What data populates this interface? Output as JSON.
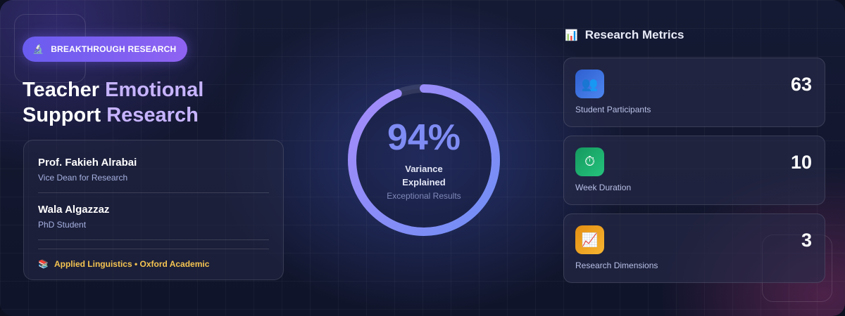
{
  "badge": {
    "icon": "microscope-icon",
    "glyph": "🔬",
    "label": "BREAKTHROUGH RESEARCH"
  },
  "title": {
    "line1_a": "Teacher",
    "line1_b": "Emotional",
    "line2_a": "Support",
    "line2_b": "Research"
  },
  "authors": [
    {
      "name": "Prof. Fakieh Alrabai",
      "role": "Vice Dean for Research"
    },
    {
      "name": "Wala Algazzaz",
      "role": "PhD Student"
    }
  ],
  "journal": {
    "icon": "books-icon",
    "glyph": "📚",
    "label": "Applied Linguistics • Oxford Academic"
  },
  "stat": {
    "value_text": "94%",
    "progress": 94,
    "label_line1": "Variance",
    "label_line2": "Explained",
    "sublabel": "Exceptional Results"
  },
  "metrics": {
    "header_icon": "bar-chart-icon",
    "header_glyph": "📊",
    "title": "Research Metrics",
    "items": [
      {
        "icon": "people-icon",
        "glyph": "👥",
        "value": "63",
        "label": "Student Participants",
        "color": "#3b6fe0"
      },
      {
        "icon": "stopwatch-icon",
        "glyph": "⏱",
        "value": "10",
        "label": "Week Duration",
        "color": "#1fae6e"
      },
      {
        "icon": "trend-chart-icon",
        "glyph": "📈",
        "value": "3",
        "label": "Research Dimensions",
        "color": "#f0a41e"
      }
    ]
  },
  "colors": {
    "accent": "#8f63f2",
    "ring_start": "#6f8ef5",
    "ring_end": "#a78bfa",
    "journal": "#f5c451"
  }
}
